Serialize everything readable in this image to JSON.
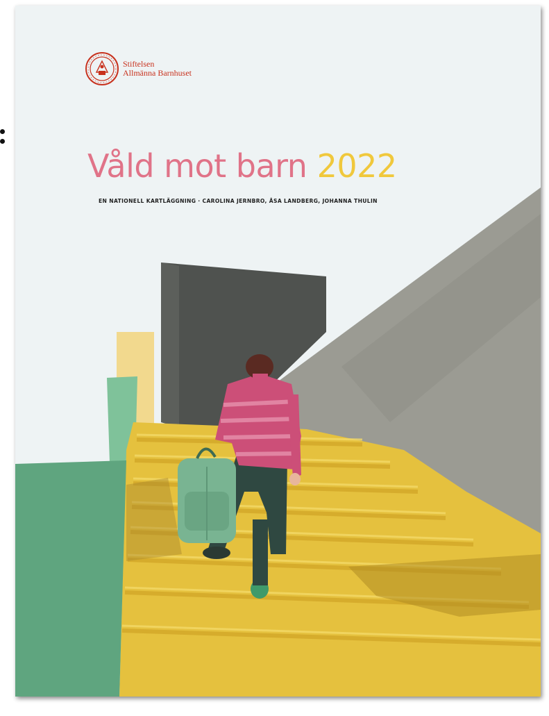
{
  "bullets": 2,
  "cover": {
    "logo": {
      "line1": "Stiftelsen",
      "line2": "Allmänna Barnhuset"
    },
    "title_main": "Våld mot barn",
    "title_year": "2022",
    "subtitle": "EN NATIONELL KARTLÄGGNING · CAROLINA JERNBRO, ÅSA LANDBERG, JOHANNA THULIN"
  },
  "colors": {
    "background": "#eef3f4",
    "title_pink": "#e07388",
    "title_yellow": "#f0c83c",
    "logo_red": "#c8321e",
    "stairs_yellow": "#e8c23a",
    "wall_gray": "#9a9a92",
    "rail_green": "#5fa57f",
    "sweater_pink": "#cc4f78"
  }
}
